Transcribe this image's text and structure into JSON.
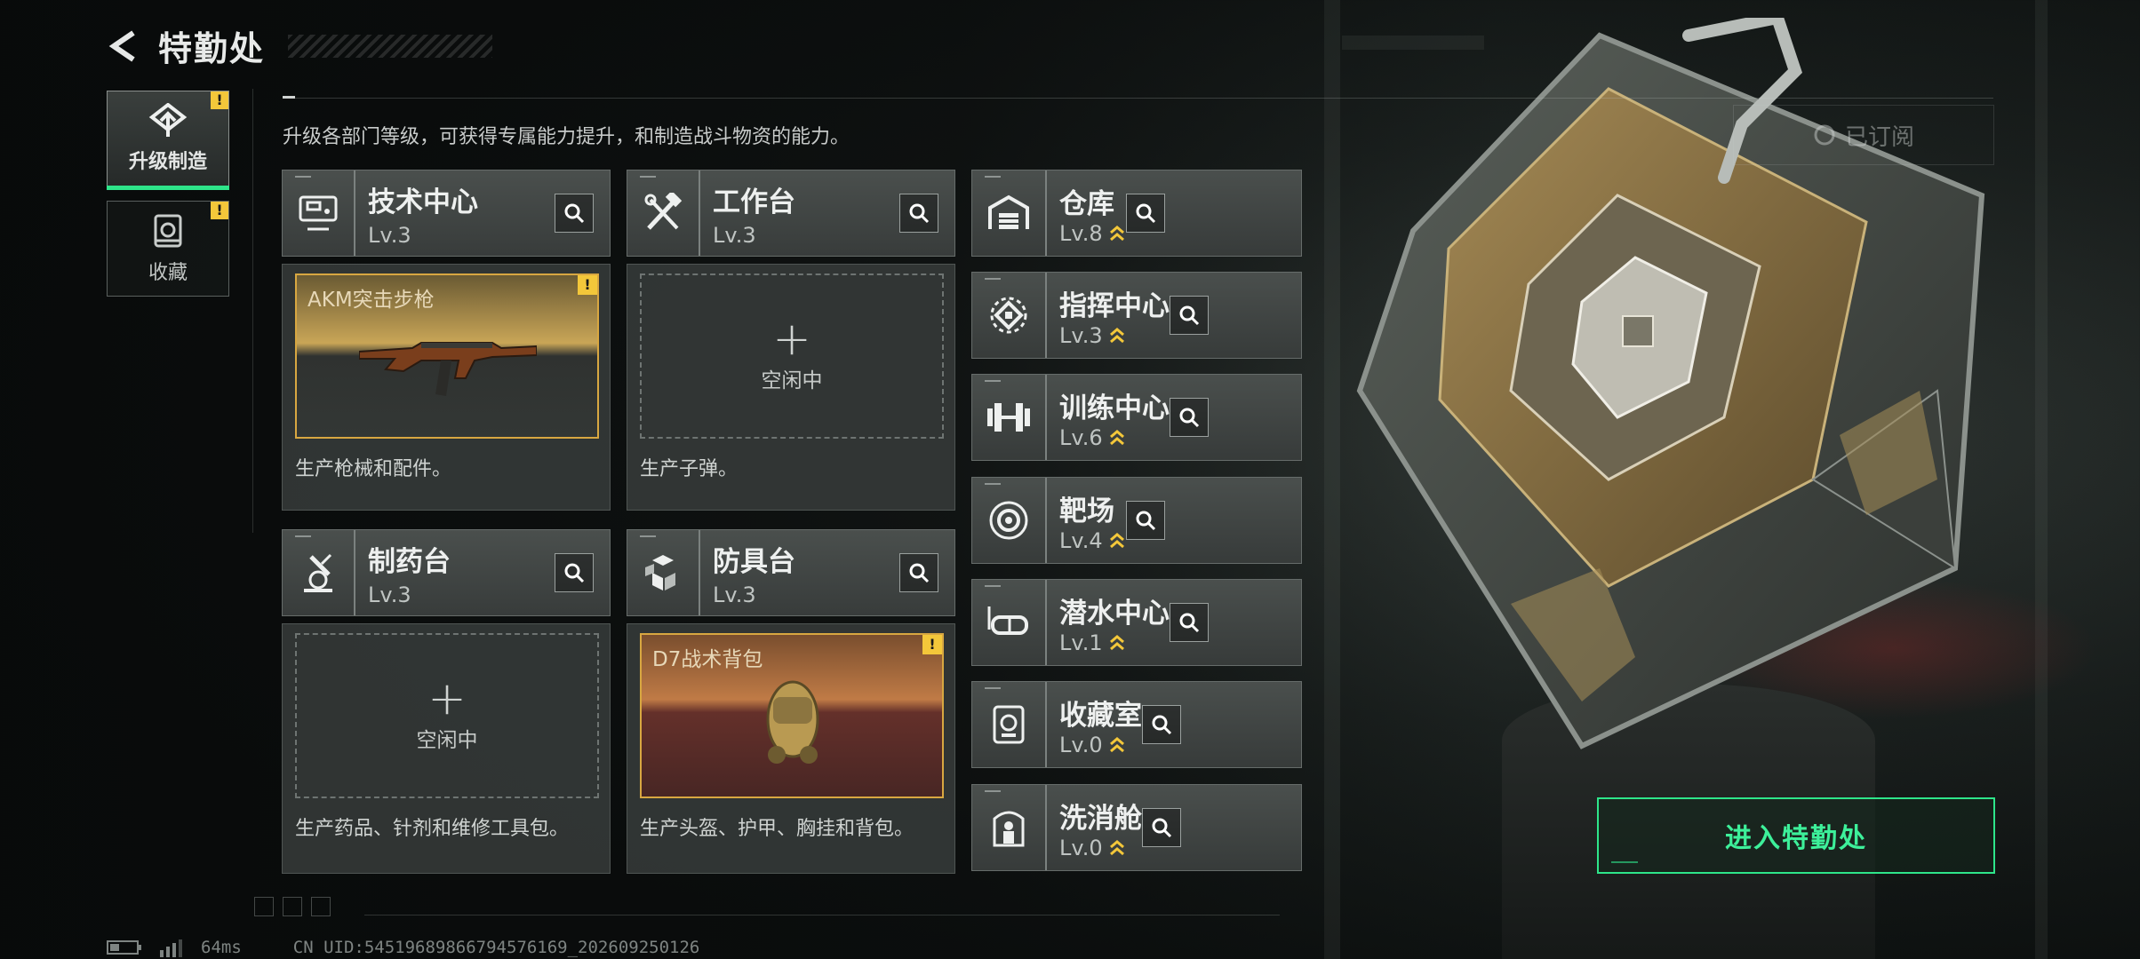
{
  "header": {
    "title": "特勤处"
  },
  "tabs": [
    {
      "label": "升级制造",
      "icon": "upgrade-icon",
      "badge": "!"
    },
    {
      "label": "收藏",
      "icon": "collection-icon",
      "badge": "!"
    }
  ],
  "hint": "升级各部门等级，可获得专属能力提升，和制造战斗物资的能力。",
  "subscribed_label": "已订阅",
  "facilities_main": [
    {
      "name": "技术中心",
      "level": "Lv.3",
      "icon": "tech-center-icon",
      "slot_item": "AKM突击步枪",
      "slot_badge": "!",
      "desc": "生产枪械和配件。"
    },
    {
      "name": "工作台",
      "level": "Lv.3",
      "icon": "workbench-icon",
      "empty_label": "空闲中",
      "plus": "+",
      "desc": "生产子弹。"
    },
    {
      "name": "制药台",
      "level": "Lv.3",
      "icon": "pharmacy-icon",
      "empty_label": "空闲中",
      "plus": "+",
      "desc": "生产药品、针剂和维修工具包。"
    },
    {
      "name": "防具台",
      "level": "Lv.3",
      "icon": "armor-bench-icon",
      "slot_item": "D7战术背包",
      "slot_badge": "!",
      "desc": "生产头盔、护甲、胸挂和背包。"
    }
  ],
  "facilities_side": [
    {
      "name": "仓库",
      "level": "Lv.8",
      "icon": "warehouse-icon"
    },
    {
      "name": "指挥中心",
      "level": "Lv.3",
      "icon": "command-center-icon"
    },
    {
      "name": "训练中心",
      "level": "Lv.6",
      "icon": "training-center-icon"
    },
    {
      "name": "靶场",
      "level": "Lv.4",
      "icon": "shooting-range-icon"
    },
    {
      "name": "潜水中心",
      "level": "Lv.1",
      "icon": "diving-center-icon"
    },
    {
      "name": "收藏室",
      "level": "Lv.0",
      "icon": "collection-room-icon"
    },
    {
      "name": "洗消舱",
      "level": "Lv.0",
      "icon": "decontamination-icon"
    }
  ],
  "enter_label": "进入特勤处",
  "status": {
    "ping": "64ms",
    "uid": "CN UID:5451968986679457616​9_202609250126"
  },
  "colors": {
    "accent": "#2ee58a",
    "warning": "#f3c73a",
    "item_border": "#d8a741"
  }
}
